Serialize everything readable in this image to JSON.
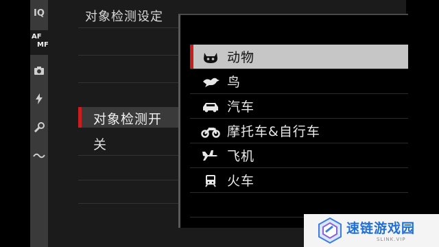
{
  "header": {
    "title": "对象检测设定"
  },
  "rail": {
    "items": [
      {
        "label": "IQ"
      },
      {
        "label_top": "AF",
        "label_bottom": "MF"
      }
    ]
  },
  "setting": {
    "label": "对象检测开",
    "value": "关"
  },
  "popup": {
    "items": [
      {
        "label": "动物",
        "icon": "cat-icon",
        "selected": true
      },
      {
        "label": "鸟",
        "icon": "bird-icon"
      },
      {
        "label": "汽车",
        "icon": "car-icon"
      },
      {
        "label": "摩托车&自行车",
        "icon": "motorcycle-icon"
      },
      {
        "label": "飞机",
        "icon": "airplane-icon"
      },
      {
        "label": "火车",
        "icon": "train-icon"
      }
    ]
  },
  "watermark": {
    "text": "速链游戏园",
    "sub": "SLINK.VIP"
  },
  "colors": {
    "accent": "#c81e1e",
    "selected_bg": "#c6c6c6",
    "watermark_blue": "#1f6fd6"
  }
}
